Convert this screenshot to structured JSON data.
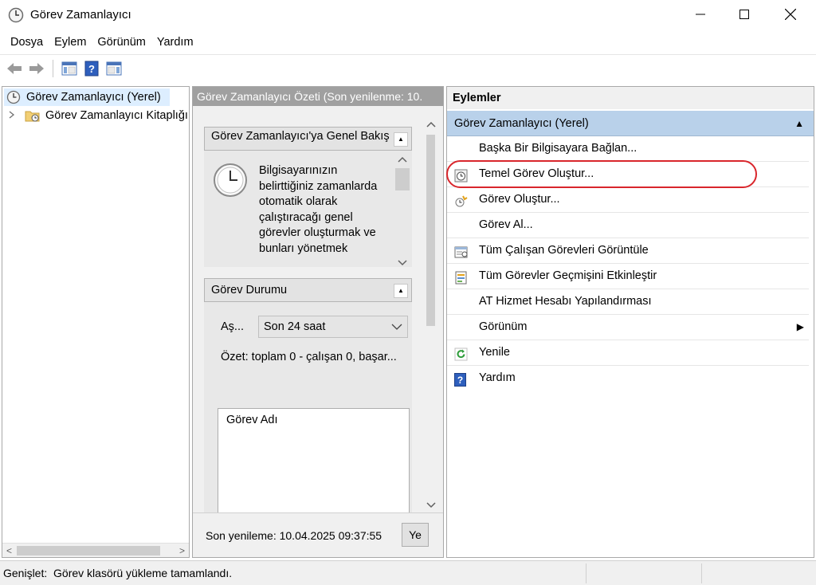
{
  "window": {
    "title": "Görev Zamanlayıcı",
    "icon": "clock-icon"
  },
  "menu": [
    "Dosya",
    "Eylem",
    "Görünüm",
    "Yardım"
  ],
  "toolbar": {
    "icons": [
      "back-arrow-icon",
      "forward-arrow-icon",
      "show-hide-console-tree-icon",
      "help-icon",
      "show-hide-action-pane-icon"
    ]
  },
  "tree": {
    "root_label": "Görev Zamanlayıcı (Yerel)",
    "child_label": "Görev Zamanlayıcı Kitaplığı"
  },
  "middle": {
    "header": "Görev Zamanlayıcı Özeti (Son yenilenme: 10.",
    "overview": {
      "title": "Görev Zamanlayıcı'ya Genel Bakış",
      "body": "Bilgisayarınızın belirttiğiniz zamanlarda otomatik olarak çalıştıracağı genel görevler oluşturmak ve bunları yönetmek"
    },
    "status": {
      "title": "Görev Durumu",
      "filter_label": "Aş...",
      "filter_value": "Son 24 saat",
      "summary": "Özet: toplam 0 - çalışan 0, başar...",
      "list_header": "Görev Adı"
    },
    "footer": {
      "last_refresh": "Son yenileme: 10.04.2025 09:37:55",
      "refresh_button": "Ye"
    }
  },
  "actions": {
    "title": "Eylemler",
    "group": "Görev Zamanlayıcı (Yerel)",
    "items": [
      {
        "label": "Başka Bir Bilgisayara Bağlan...",
        "icon": ""
      },
      {
        "label": "Temel Görev Oluştur...",
        "icon": "create-basic-task-icon"
      },
      {
        "label": "Görev Oluştur...",
        "icon": "create-task-icon"
      },
      {
        "label": "Görev Al...",
        "icon": ""
      },
      {
        "label": "Tüm Çalışan Görevleri Görüntüle",
        "icon": "running-tasks-icon"
      },
      {
        "label": "Tüm Görevler Geçmişini Etkinleştir",
        "icon": "history-icon"
      },
      {
        "label": "AT Hizmet Hesabı Yapılandırması",
        "icon": ""
      },
      {
        "label": "Görünüm",
        "icon": ""
      },
      {
        "label": "Yenile",
        "icon": "refresh-icon"
      },
      {
        "label": "Yardım",
        "icon": "help-icon"
      }
    ]
  },
  "statusbar": {
    "message": "Genişlet:  Görev klasörü yükleme tamamlandı."
  },
  "colors": {
    "action_group_bg": "#b9d1ea",
    "tree_selection": "#ddeeff",
    "highlight_oval": "#d9262c",
    "middle_header_bg": "#a0a0a0"
  }
}
